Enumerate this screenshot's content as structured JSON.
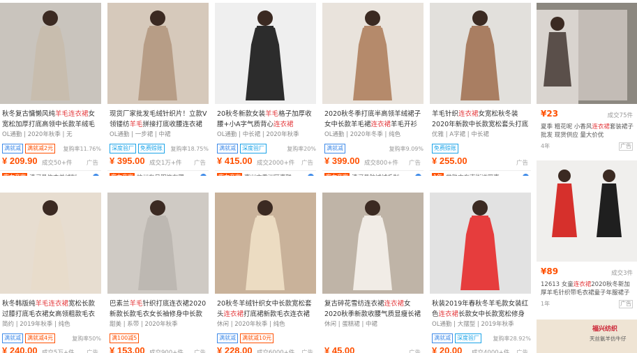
{
  "products": [
    {
      "title_pre": "秋冬复古慵懒风纯",
      "title_hl": "羊毛连衣裙",
      "title_post": "女宽松加厚打底高领中长款羊绒毛衣裙",
      "meta": "OL通勤 | 2020年秋季 | 无",
      "tags": [
        {
          "t": "满就减",
          "c": "blue"
        },
        {
          "t": "满就减2元",
          "c": "red"
        }
      ],
      "repurchase": "复购率11.76%",
      "price": "¥ 209.90",
      "sold": "成交50+件",
      "ad": "广告",
      "shop": "实力商家",
      "shop_name": "清河县依杰羊绒制",
      "bg": "#c9c4bd",
      "dress": "#c8bdae"
    },
    {
      "title_pre": "现货厂家批发毛绒针织片！立款V领镂纺",
      "title_hl": "羊毛",
      "title_post": "拼接打底收腰连衣裙女",
      "meta": "OL通勤 | 一步裙 | 中裙",
      "tags": [
        {
          "t": "深度验厂",
          "c": "cyan"
        },
        {
          "t": "免费赊账",
          "c": "cyan"
        }
      ],
      "repurchase": "复购率18.75%",
      "price": "¥ 395.00",
      "sold": "成交1万+件",
      "ad": "广告",
      "shop": "实力商家",
      "shop_name": "杭州有号服饰有限...",
      "bg": "#d6c9bb",
      "dress": "#b79d86"
    },
    {
      "title_pre": "20秋冬新款女装",
      "title_hl": "羊毛",
      "title_post": "格子加厚收腰+小A字气质背心",
      "title_hl2": "连衣裙",
      "meta": "OL通勤 | 中长裙 | 2020年秋季",
      "tags": [
        {
          "t": "满就减",
          "c": "blue"
        },
        {
          "t": "深度验厂",
          "c": "cyan"
        }
      ],
      "repurchase": "复购率20%",
      "price": "¥ 415.00",
      "sold": "成交2000+件",
      "ad": "广告",
      "shop": "实力商家",
      "shop_name": "嘉兴市秀洲区嘉联...",
      "bg": "#efefef",
      "dress": "#2c2c2c"
    },
    {
      "title_pre": "2020秋冬季打底半高领羊绒裙子女中长款羊毛裙",
      "title_hl": "连衣裙",
      "title_post": "羊毛开衫长裙",
      "meta": "OL通勤 | 2020年冬季 | 纯色",
      "tags": [
        {
          "t": "满就减",
          "c": "blue"
        }
      ],
      "repurchase": "复购率9.09%",
      "price": "¥ 399.00",
      "sold": "成交800+件",
      "ad": "广告",
      "shop": "实力商家",
      "shop_name": "清河县航城绒毛制...",
      "bg": "#e9e3dc",
      "dress": "#b58a6b"
    },
    {
      "title_pre": "羊毛针织",
      "title_hl": "连衣裙",
      "title_post": "女宽松秋冬装2020年新款中长款宽松套头打底针织内搭裙子气",
      "meta": "优雅 | A字裙 | 中长裙",
      "tags": [
        {
          "t": "免费赊账",
          "c": "cyan"
        }
      ],
      "repurchase": "",
      "price": "¥ 255.00",
      "sold": "",
      "ad": "广告",
      "shop": "1年",
      "shop_name": "常熟市东南街道罗嘉...",
      "bg": "#e2e0dc",
      "dress": "#a97e62"
    },
    {
      "title_pre": "秋冬韩版纯",
      "title_hl": "羊毛连衣裙",
      "title_post": "宽松长款过膝打底毛衣裙女高领粗款毛衣针织衫",
      "meta": "简约 | 2019年秋季 | 纯色",
      "tags": [
        {
          "t": "满就减",
          "c": "blue"
        },
        {
          "t": "满就减4元",
          "c": "red"
        }
      ],
      "repurchase": "复购率50%",
      "price": "¥ 240.00",
      "sold": "成交5万+件",
      "ad": "广告",
      "shop": "",
      "shop_name": "",
      "bg": "#e7ddd0",
      "dress": "#e8dccb"
    },
    {
      "title_pre": "巴素兰",
      "title_hl": "羊毛",
      "title_post": "针织打底连衣裙2020新款长款毛衣女长袖修身中长款过膝",
      "meta": "甜美 | 系带 | 2020年秋季",
      "tags": [
        {
          "t": "满100减5",
          "c": "red"
        }
      ],
      "repurchase": "",
      "price": "¥ 153.00",
      "sold": "成交900+件",
      "ad": "广告",
      "shop": "",
      "shop_name": "",
      "bg": "#cfcac4",
      "dress": "#bdb8b2"
    },
    {
      "title_pre": "20秋冬羊绒针织女中长款宽松套头",
      "title_hl": "连衣裙",
      "title_post": "打底裙新款毛衣连衣裙羊毛针织毛衣",
      "meta": "休闲 | 2020年秋季 | 纯色",
      "tags": [
        {
          "t": "满就减",
          "c": "blue"
        },
        {
          "t": "满就减10元",
          "c": "red"
        }
      ],
      "repurchase": "",
      "price": "¥ 228.00",
      "sold": "成交6000+件",
      "ad": "广告",
      "shop": "",
      "shop_name": "",
      "bg": "#c9b29a",
      "dress": "#ecdcc2"
    },
    {
      "title_pre": "复古碎花雪纺连衣裙",
      "title_hl": "连衣裙",
      "title_post": "女2020秋季新款收腰气质显瘦长裙28149",
      "meta": "休闲 | 蛋糕裙 | 中裙",
      "tags": [],
      "repurchase": "",
      "price": "¥ 45.00",
      "sold": "",
      "ad": "广告",
      "shop": "",
      "shop_name": "",
      "bg": "#bfb4a7",
      "dress": "#f1ece6"
    },
    {
      "title_pre": "秋装2019年春秋冬羊毛款女装红色",
      "title_hl": "连衣裙",
      "title_post": "长款女中长款宽松修身裙子",
      "meta": "OL通勤 | 大摆型 | 2019年秋季",
      "tags": [
        {
          "t": "满就减",
          "c": "blue"
        },
        {
          "t": "深度验厂",
          "c": "cyan"
        }
      ],
      "repurchase": "复购率28.92%",
      "price": "¥ 20.00",
      "sold": "成交4000+件",
      "ad": "广告",
      "shop": "",
      "shop_name": "",
      "bg": "#e2e2e2",
      "dress": "#e63d3d"
    }
  ],
  "side": [
    {
      "price": "¥23",
      "sold": "成交75件",
      "title_pre": "夏季 粗花呢 小香风",
      "title_hl": "连衣裙",
      "title_post": "套装裙子 批发 现货供应 量大价优",
      "year": "4年",
      "ad": "广告"
    },
    {
      "price": "¥89",
      "sold": "成交3件",
      "title_pre": "12613 女童",
      "title_hl": "连衣裙",
      "title_post": "2020秋冬新加厚羊毛针织带毛衣裙童子年服裙子",
      "year": "1年",
      "ad": "广告",
      "badge": "超级新品"
    },
    {
      "banner": "福兴纺织",
      "banner_sub": "天丝氨羊仿牛仔"
    }
  ]
}
